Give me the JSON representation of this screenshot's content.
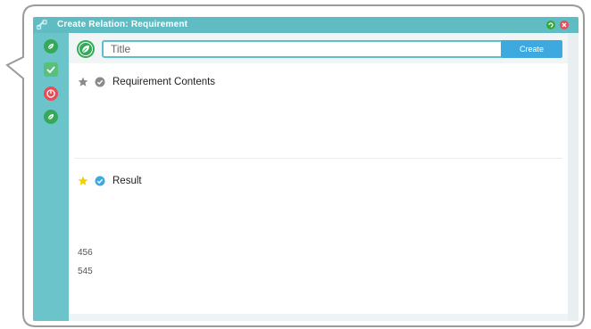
{
  "window": {
    "title": "Create Relation: Requirement"
  },
  "sidebar": {
    "items": [
      {
        "icon": "leaf-icon",
        "color": "#35a95a"
      },
      {
        "icon": "shield-check-icon",
        "color": "#58c07a"
      },
      {
        "icon": "power-icon",
        "color": "#e94c57"
      },
      {
        "icon": "leaf-icon",
        "color": "#35a95a"
      }
    ]
  },
  "form": {
    "title_placeholder": "Title",
    "create_label": "Create"
  },
  "sections": [
    {
      "label": "Requirement Contents",
      "starred": false,
      "checked": false
    },
    {
      "label": "Result",
      "starred": true,
      "checked": true
    }
  ],
  "result_values": [
    "456",
    "545"
  ],
  "colors": {
    "accent": "#6ac4c9",
    "button": "#3ea9de",
    "star_active": "#f5d000",
    "check_active": "#3ea9de",
    "inactive": "#8a8a8a"
  }
}
